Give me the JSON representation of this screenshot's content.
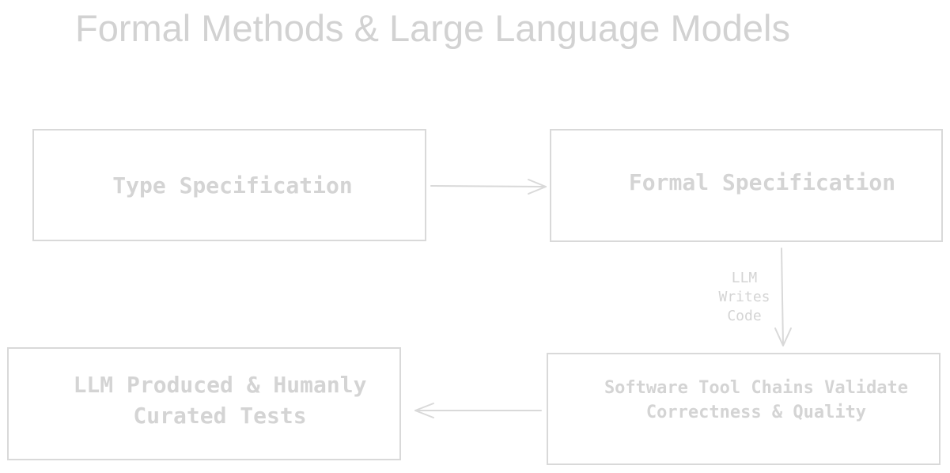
{
  "title": "Formal Methods & Large Language Models",
  "nodes": {
    "type_spec": "Type Specification",
    "formal_spec": "Formal Specification",
    "tool_chains": "Software Tool Chains Validate\nCorrectness & Quality",
    "tests": "LLM Produced & Humanly\nCurated Tests"
  },
  "edges": {
    "formal_to_tools_label": "LLM\nWrites\nCode"
  },
  "colors": {
    "stroke": "#d9d9d9",
    "text": "#d4d4d4",
    "background": "#ffffff"
  }
}
